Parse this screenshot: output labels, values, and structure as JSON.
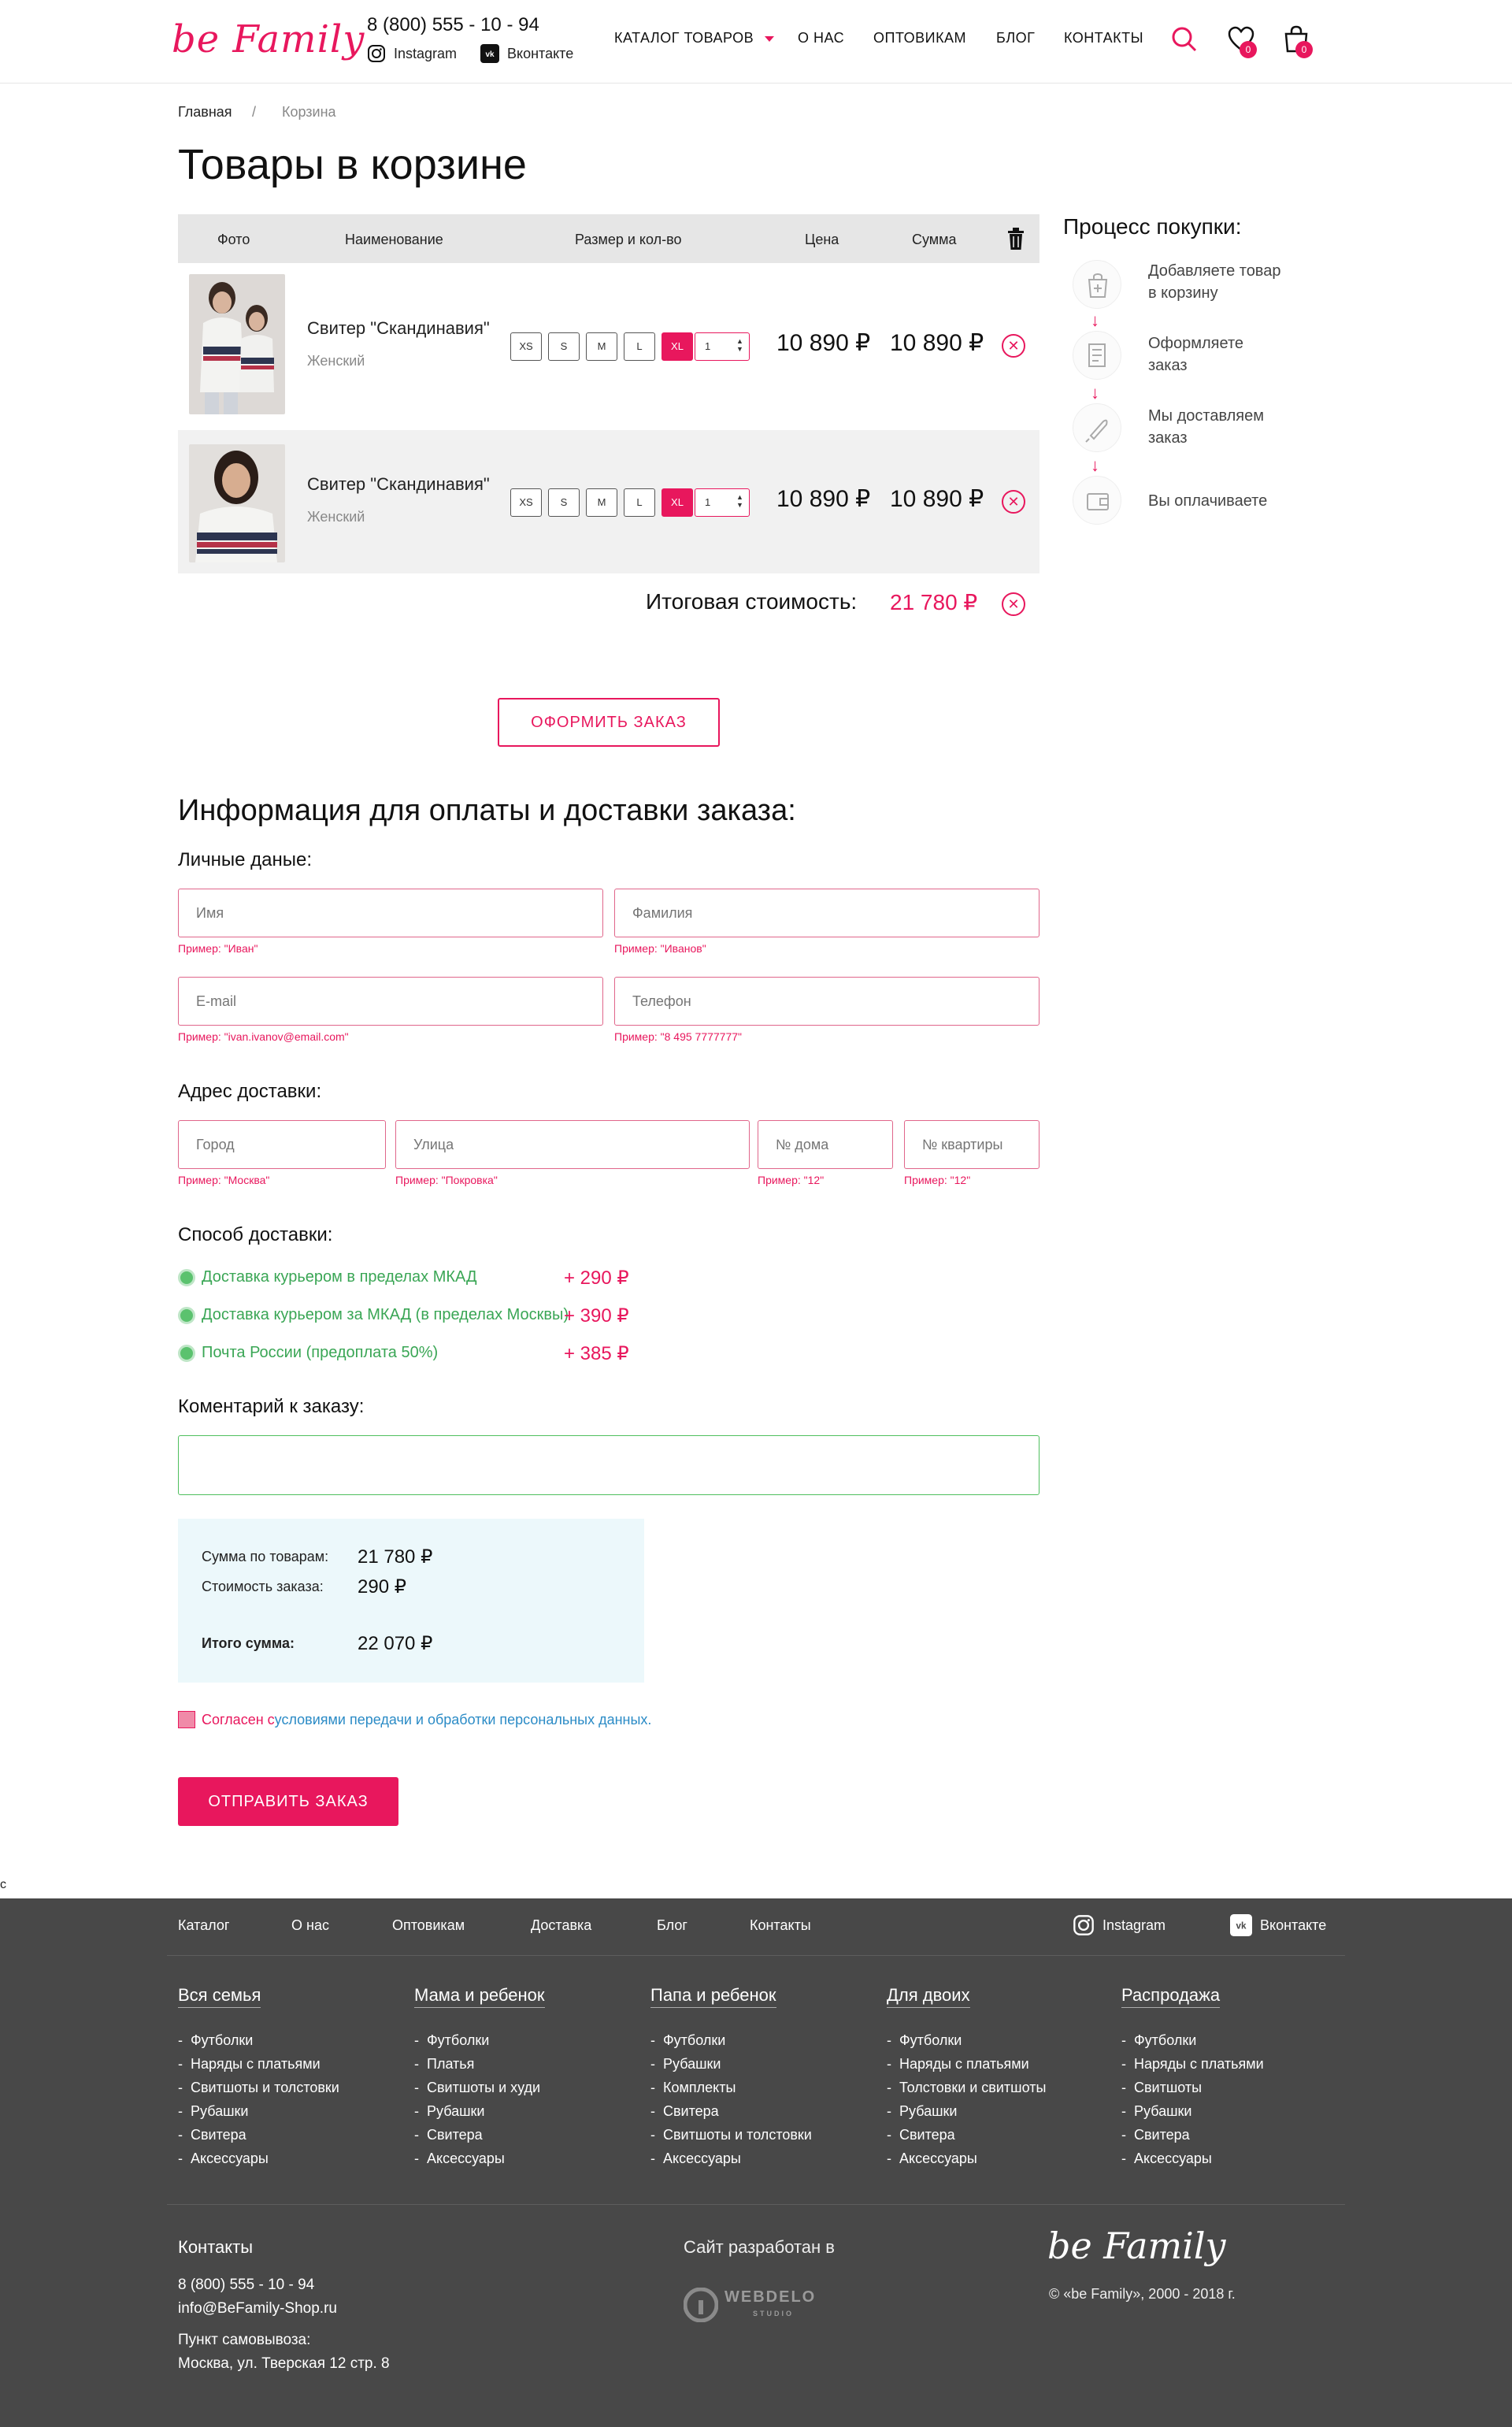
{
  "header": {
    "logo": "be Family",
    "phone": "8 (800) 555 - 10 - 94",
    "instagram": "Instagram",
    "vk": "Вконтакте",
    "nav": [
      "КАТАЛОГ ТОВАРОВ",
      "О НАС",
      "ОПТОВИКАМ",
      "БЛОГ",
      "КОНТАКТЫ"
    ],
    "wishlist_count": "0",
    "cart_count": "0"
  },
  "breadcrumb": {
    "home": "Главная",
    "sep": "/",
    "current": "Корзина"
  },
  "page_title": "Товары в корзине",
  "cart": {
    "columns": [
      "Фото",
      "Наименование",
      "Размер и кол-во",
      "Цена",
      "Сумма"
    ],
    "items": [
      {
        "name": "Свитер \"Скандинавия\"",
        "sub": "Женский",
        "sizes": [
          "XS",
          "S",
          "M",
          "L",
          "XL"
        ],
        "selected": "XL",
        "qty": "1",
        "price": "10 890 ₽",
        "total": "10 890 ₽"
      },
      {
        "name": "Свитер \"Скандинавия\"",
        "sub": "Женский",
        "sizes": [
          "XS",
          "S",
          "M",
          "L",
          "XL"
        ],
        "selected": "XL",
        "qty": "1",
        "price": "10 890 ₽",
        "total": "10 890 ₽"
      }
    ],
    "total_label": "Итоговая стоимость:",
    "total_value": "21 780 ₽"
  },
  "process": {
    "title": "Процесс покупки:",
    "steps": [
      [
        "Добавляете товар",
        "в корзину"
      ],
      [
        "Оформляете",
        "заказ"
      ],
      [
        "Мы доставляем",
        "заказ"
      ],
      [
        "Вы оплачиваете",
        ""
      ]
    ],
    "arrow": "↓"
  },
  "checkout_button": "ОФОРМИТЬ ЗАКАЗ",
  "form": {
    "title": "Информация для оплаты и доставки заказа:",
    "personal_label": "Личные даные:",
    "name": {
      "placeholder": "Имя",
      "hint": "Пример: \"Иван\""
    },
    "surname": {
      "placeholder": "Фамилия",
      "hint": "Пример: \"Иванов\""
    },
    "email": {
      "placeholder": "E-mail",
      "hint": "Пример: \"ivan.ivanov@email.com\""
    },
    "phone": {
      "placeholder": "Телефон",
      "hint": "Пример: \"8 495 7777777\""
    },
    "address_label": "Адрес доставки:",
    "city": {
      "placeholder": "Город",
      "hint": "Пример: \"Москва\""
    },
    "street": {
      "placeholder": "Улица",
      "hint": "Пример: \"Покровка\""
    },
    "house": {
      "placeholder": "№ дома",
      "hint": "Пример: \"12\""
    },
    "flat": {
      "placeholder": "№ квартиры",
      "hint": "Пример: \"12\""
    },
    "delivery_label": "Способ доставки:",
    "delivery": [
      {
        "label": "Доставка курьером в пределах МКАД",
        "price": "+ 290 ₽"
      },
      {
        "label": "Доставка курьером за МКАД (в пределах Москвы)",
        "price": "+ 390 ₽"
      },
      {
        "label": "Почта России (предоплата 50%)",
        "price": "+ 385 ₽"
      }
    ],
    "comment_label": "Коментарий к заказу:"
  },
  "summary": {
    "goods_label": "Сумма по товарам:",
    "goods_value": "21 780 ₽",
    "delivery_label": "Стоимость заказа:",
    "delivery_value": "290 ₽",
    "total_label": "Итого сумма:",
    "total_value": "22 070 ₽"
  },
  "agree": {
    "prefix": "Согласен с ",
    "link": "условиями передачи и обработки персональных данных."
  },
  "submit_button": "ОТПРАВИТЬ ЗАКАЗ",
  "stray_char": "c",
  "footer": {
    "nav": [
      "Каталог",
      "О нас",
      "Оптовикам",
      "Доставка",
      "Блог",
      "Контакты"
    ],
    "instagram": "Instagram",
    "vk": "Вконтакте",
    "columns": [
      {
        "title": "Вся семья",
        "items": [
          "Футболки",
          "Наряды с платьями",
          "Свитшоты и толстовки",
          "Рубашки",
          "Свитера",
          "Аксессуары"
        ]
      },
      {
        "title": "Мама и ребенок",
        "items": [
          "Футболки",
          "Платья",
          "Свитшоты и худи",
          "Рубашки",
          "Свитера",
          "Аксессуары"
        ]
      },
      {
        "title": "Папа и ребенок",
        "items": [
          "Футболки",
          "Рубашки",
          "Комплекты",
          "Свитера",
          "Свитшоты и толстовки",
          "Аксессуары"
        ]
      },
      {
        "title": "Для двоих",
        "items": [
          "Футболки",
          "Наряды с платьями",
          "Толстовки и свитшоты",
          "Рубашки",
          "Свитера",
          "Аксессуары"
        ]
      },
      {
        "title": "Распродажа",
        "items": [
          "Футболки",
          "Наряды с платьями",
          "Свитшоты",
          "Рубашки",
          "Свитера",
          "Аксессуары"
        ]
      }
    ],
    "contacts_title": "Контакты",
    "contacts_phone": "8 (800) 555 - 10 - 94",
    "contacts_email": "info@BeFamily-Shop.ru",
    "pickup_label": "Пункт самовывоза:",
    "pickup_address": "Москва, ул. Тверская 12 стр. 8",
    "dev_label": "Сайт разработан в",
    "dev_name": "WEBDELO",
    "dev_sub": "STUDIO",
    "logo": "be Family",
    "copyright": "© «be Family», 2000 - 2018 г."
  },
  "colors": {
    "accent": "#e8175d",
    "footer_bg": "#484848",
    "green": "#3aa655",
    "summary_bg": "#ecf8fb"
  }
}
